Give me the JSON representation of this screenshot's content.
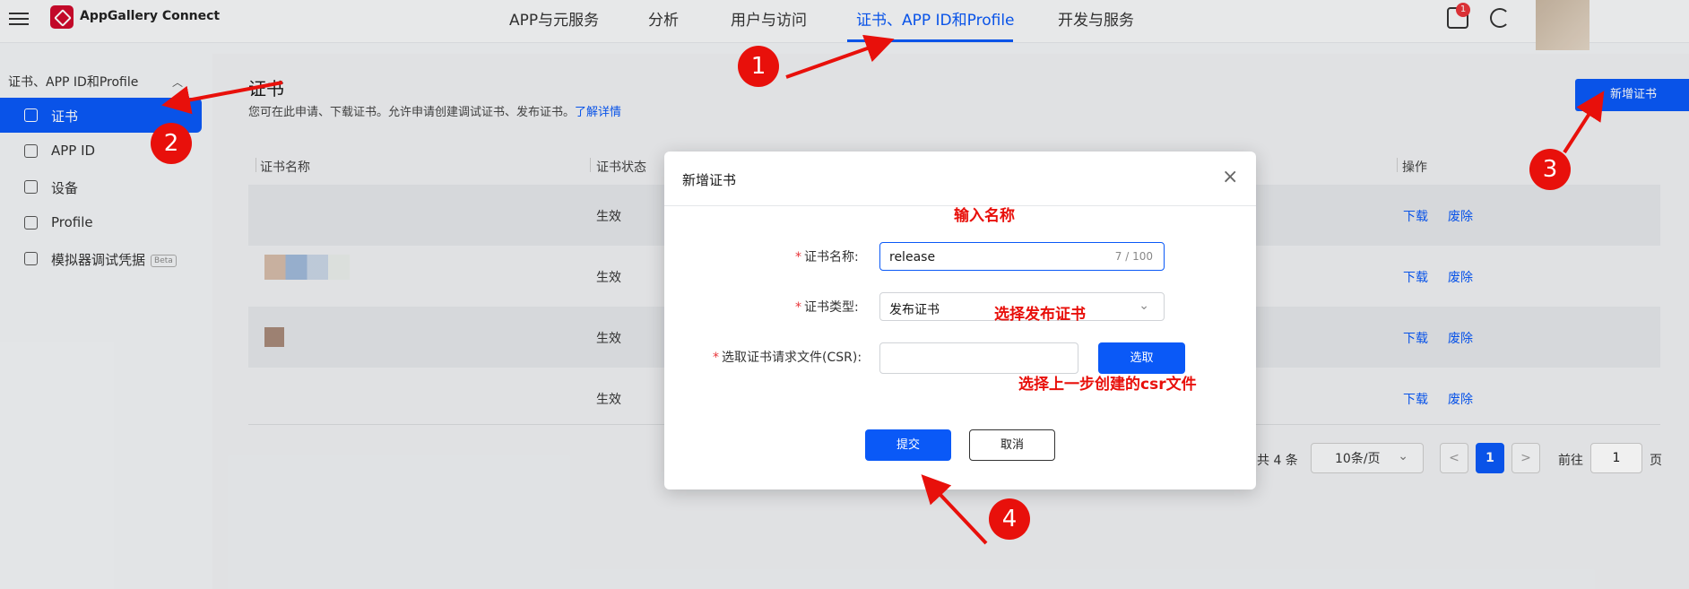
{
  "topbar": {
    "app_name": "AppGallery Connect",
    "nav": [
      "APP与元服务",
      "分析",
      "用户与访问",
      "证书、APP ID和Profile",
      "开发与服务"
    ],
    "active_nav_index": 3,
    "badge_count": "1"
  },
  "sidebar": {
    "group": "证书、APP ID和Profile",
    "items": [
      {
        "label": "证书"
      },
      {
        "label": "APP ID"
      },
      {
        "label": "设备"
      },
      {
        "label": "Profile"
      },
      {
        "label": "模拟器调试凭据",
        "badge": "Beta"
      }
    ],
    "active_index": 0
  },
  "page": {
    "title": "证书",
    "description": "您可在此申请、下载证书。允许申请创建调试证书、发布证书。",
    "learn_more": "了解详情",
    "add_button": "新增证书"
  },
  "table": {
    "headers": [
      "证书名称",
      "证书状态",
      "操作"
    ],
    "rows": [
      {
        "status": "生效",
        "download": "下载",
        "revoke": "废除"
      },
      {
        "status": "生效",
        "download": "下载",
        "revoke": "废除"
      },
      {
        "status": "生效",
        "download": "下载",
        "revoke": "废除"
      },
      {
        "status": "生效",
        "download": "下载",
        "revoke": "废除"
      }
    ]
  },
  "pagination": {
    "total": "共 4 条",
    "page_size": "10条/页",
    "prev": "<",
    "current": "1",
    "next": ">",
    "goto_label": "前往",
    "goto_value": "1",
    "goto_unit": "页"
  },
  "dialog": {
    "title": "新增证书",
    "close": "×",
    "name_label": "证书名称:",
    "name_value": "release",
    "name_count": "7 / 100",
    "type_label": "证书类型:",
    "type_value": "发布证书",
    "csr_label": "选取证书请求文件(CSR):",
    "select_button": "选取",
    "submit_button": "提交",
    "cancel_button": "取消"
  },
  "annotations": {
    "hint_name": "输入名称",
    "hint_type": "选择发布证书",
    "hint_csr": "选择上一步创建的csr文件",
    "steps": [
      "1",
      "2",
      "3",
      "4"
    ],
    "color": "#e8100b"
  },
  "colors": {
    "primary": "#0a59f7",
    "annotation": "#e8100b"
  }
}
